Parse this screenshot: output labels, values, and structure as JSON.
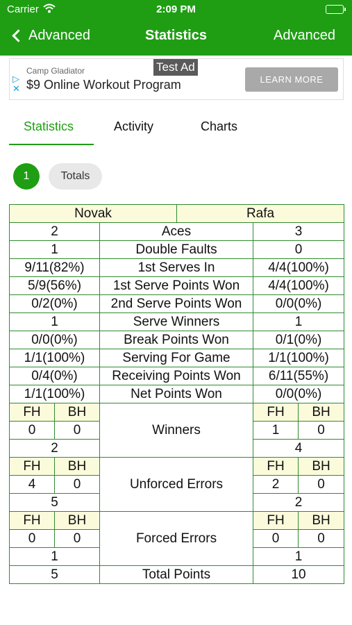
{
  "status_bar": {
    "carrier": "Carrier",
    "time": "2:09 PM"
  },
  "nav": {
    "back_label": "Advanced",
    "title": "Statistics",
    "right_label": "Advanced"
  },
  "ad": {
    "brand": "Camp Gladiator",
    "headline": "$9 Online Workout Program",
    "test_label": "Test Ad",
    "cta": "LEARN MORE"
  },
  "tabs": [
    {
      "label": "Statistics",
      "active": true
    },
    {
      "label": "Activity",
      "active": false
    },
    {
      "label": "Charts",
      "active": false
    }
  ],
  "filters": {
    "set_label": "1",
    "totals_label": "Totals"
  },
  "table": {
    "player1": "Novak",
    "player2": "Rafa",
    "rows": [
      {
        "label": "Aces",
        "p1": "2",
        "p2": "3"
      },
      {
        "label": "Double Faults",
        "p1": "1",
        "p2": "0"
      },
      {
        "label": "1st Serves In",
        "p1": "9/11(82%)",
        "p2": "4/4(100%)"
      },
      {
        "label": "1st Serve Points Won",
        "p1": "5/9(56%)",
        "p2": "4/4(100%)"
      },
      {
        "label": "2nd Serve Points Won",
        "p1": "0/2(0%)",
        "p2": "0/0(0%)"
      },
      {
        "label": "Serve Winners",
        "p1": "1",
        "p2": "1"
      },
      {
        "label": "Break Points Won",
        "p1": "0/0(0%)",
        "p2": "0/1(0%)"
      },
      {
        "label": "Serving For Game",
        "p1": "1/1(100%)",
        "p2": "1/1(100%)"
      },
      {
        "label": "Receiving Points Won",
        "p1": "0/4(0%)",
        "p2": "6/11(55%)"
      },
      {
        "label": "Net Points Won",
        "p1": "1/1(100%)",
        "p2": "0/0(0%)"
      }
    ],
    "fh_label": "FH",
    "bh_label": "BH",
    "splits": [
      {
        "label": "Winners",
        "p1_fh": "0",
        "p1_bh": "0",
        "p1_total": "2",
        "p2_fh": "1",
        "p2_bh": "0",
        "p2_total": "4"
      },
      {
        "label": "Unforced Errors",
        "p1_fh": "4",
        "p1_bh": "0",
        "p1_total": "5",
        "p2_fh": "2",
        "p2_bh": "0",
        "p2_total": "2"
      },
      {
        "label": "Forced Errors",
        "p1_fh": "0",
        "p1_bh": "0",
        "p1_total": "1",
        "p2_fh": "0",
        "p2_bh": "0",
        "p2_total": "1"
      }
    ],
    "total_points": {
      "label": "Total Points",
      "p1": "5",
      "p2": "10"
    }
  }
}
